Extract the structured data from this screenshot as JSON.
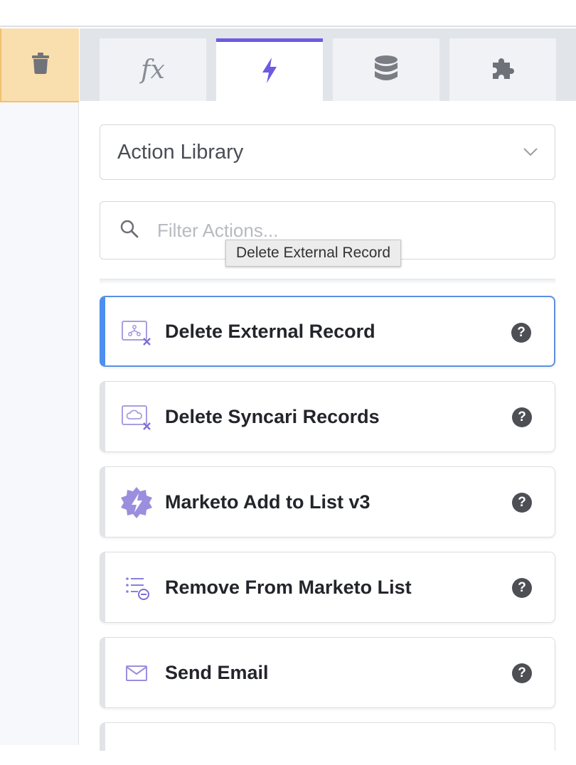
{
  "sidebar": {
    "delete_icon": "trash-icon"
  },
  "tabs": [
    {
      "id": "functions",
      "icon": "fx-icon",
      "glyph": "fx",
      "active": false
    },
    {
      "id": "actions",
      "icon": "lightning-icon",
      "active": true
    },
    {
      "id": "data",
      "icon": "database-icon",
      "active": false
    },
    {
      "id": "integrations",
      "icon": "puzzle-icon",
      "active": false
    }
  ],
  "library_select": {
    "value": "Action Library"
  },
  "filter": {
    "placeholder": "Filter Actions...",
    "value": ""
  },
  "tooltip": "Delete External Record",
  "actions": [
    {
      "title": "Delete External Record",
      "icon": "delete-external-record-icon",
      "help": "?",
      "selected": true
    },
    {
      "title": "Delete Syncari Records",
      "icon": "delete-cloud-records-icon",
      "help": "?",
      "selected": false
    },
    {
      "title": "Marketo Add to List v3",
      "icon": "gear-bolt-icon",
      "help": "?",
      "selected": false
    },
    {
      "title": "Remove From Marketo List",
      "icon": "list-remove-icon",
      "help": "?",
      "selected": false
    },
    {
      "title": "Send Email",
      "icon": "envelope-icon",
      "help": "?",
      "selected": false
    }
  ],
  "colors": {
    "accent": "#6c5ce0",
    "selected_border": "#4c8fef",
    "icon_purple": "#9b8ede",
    "trash_bg": "#f9deae"
  }
}
